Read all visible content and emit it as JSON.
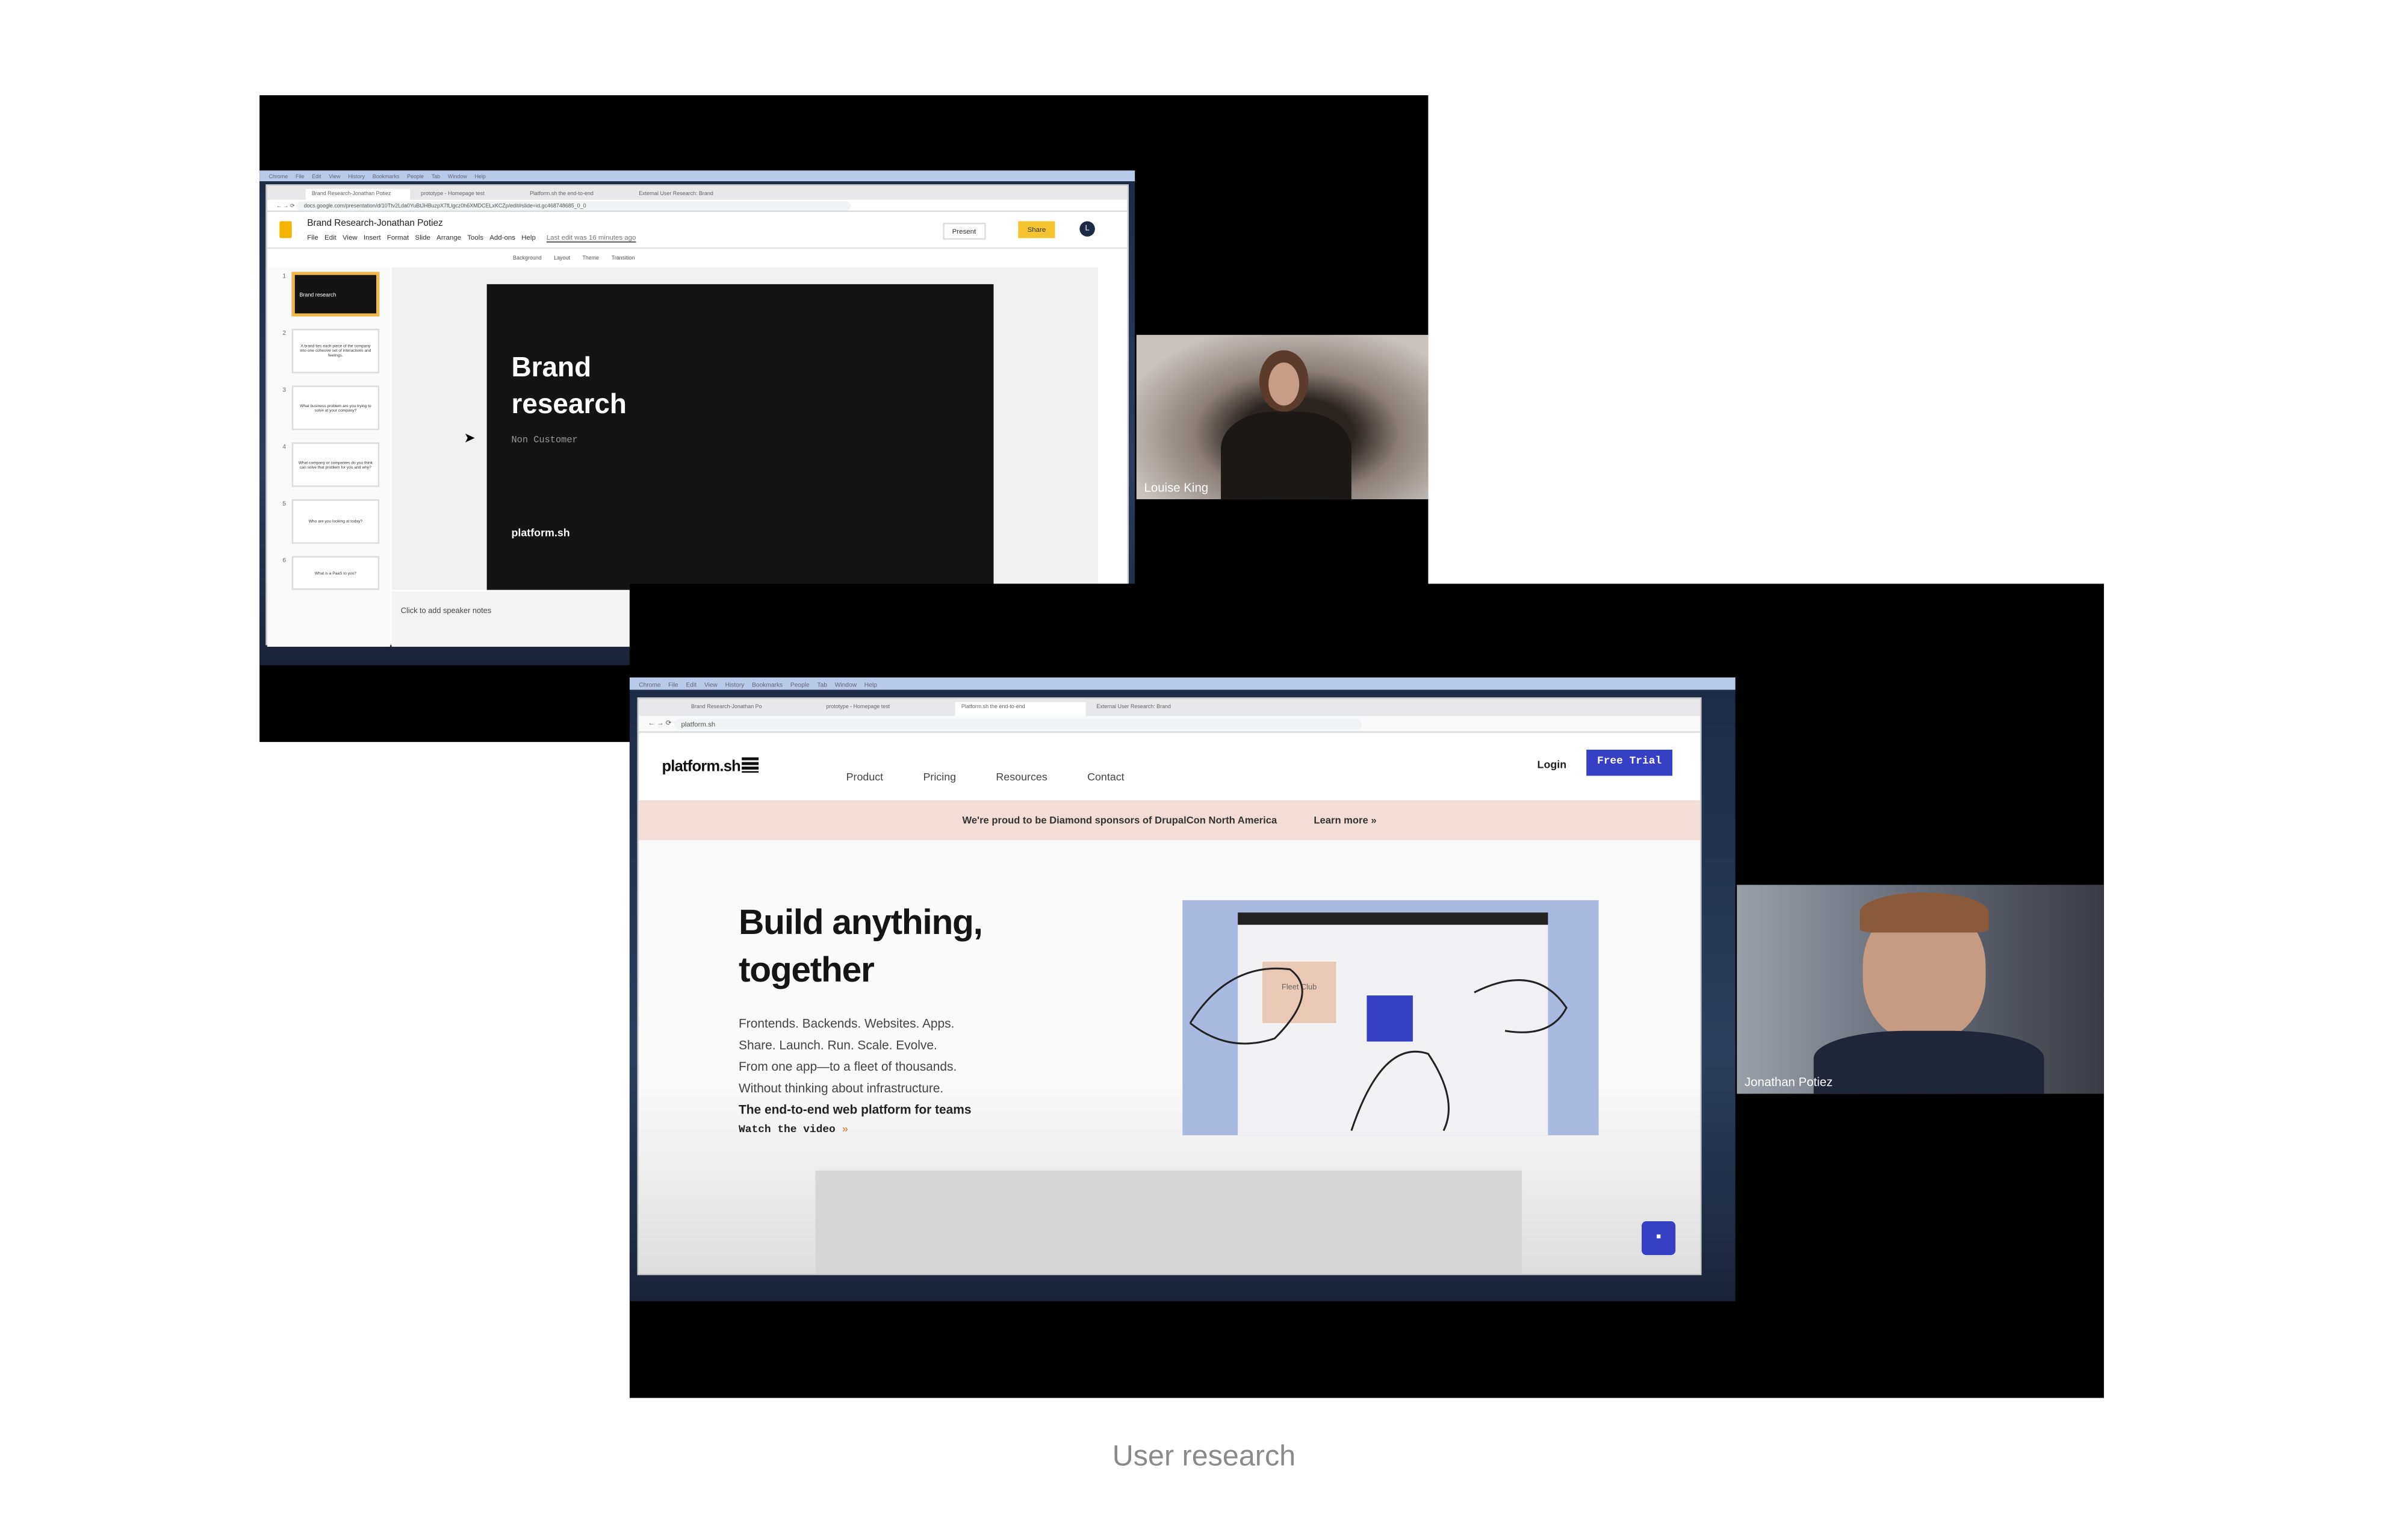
{
  "caption": "User research",
  "mac_menu": [
    "Chrome",
    "File",
    "Edit",
    "View",
    "History",
    "Bookmarks",
    "People",
    "Tab",
    "Window",
    "Help"
  ],
  "call1": {
    "participant": "Louise King",
    "browser": {
      "tabs": [
        "Brand Research-Jonathan Potiez",
        "prototype - Homepage test",
        "Platform.sh the end-to-end",
        "External User Research: Brand"
      ],
      "active_tab": 0,
      "url": "docs.google.com/presentation/d/10Ttv2Lda0YuBtJHBuzpX7fLlgcz0h6XMDCELxKCZp/edit#slide=id.gc468748685_0_0"
    },
    "slides_app": {
      "doc_title": "Brand Research-Jonathan Potiez",
      "menu": [
        "File",
        "Edit",
        "View",
        "Insert",
        "Format",
        "Slide",
        "Arrange",
        "Tools",
        "Add-ons",
        "Help"
      ],
      "last_edit": "Last edit was 16 minutes ago",
      "present_label": "Present",
      "share_label": "Share",
      "avatar_letter": "L",
      "toolbar": [
        "Background",
        "Layout",
        "Theme",
        "Transition"
      ],
      "thumbnails": [
        {
          "num": "1",
          "text": "Brand research"
        },
        {
          "num": "2",
          "text": "A brand ties each piece of the company into one cohesive set of interactions and feelings."
        },
        {
          "num": "3",
          "text": "What business problem are you trying to solve at your company?"
        },
        {
          "num": "4",
          "text": "What company or companies do you think can solve that problem for you and why?"
        },
        {
          "num": "5",
          "text": "Who are you looking at today?"
        },
        {
          "num": "6",
          "text": "What is a PaaS to you?"
        }
      ],
      "slide": {
        "title_line1": "Brand",
        "title_line2": "research",
        "subtitle": "Non Customer",
        "logo": "platform.sh"
      },
      "speaker_notes_placeholder": "Click to add speaker notes"
    }
  },
  "call2": {
    "participant": "Jonathan Potiez",
    "browser": {
      "tabs": [
        "Brand Research-Jonathan Po",
        "prototype - Homepage test",
        "Platform.sh the end-to-end",
        "External User Research: Brand"
      ],
      "active_tab": 2,
      "url": "platform.sh"
    },
    "site": {
      "logo": "platform.sh",
      "nav": [
        "Product",
        "Pricing",
        "Resources",
        "Contact"
      ],
      "login": "Login",
      "cta": "Free Trial",
      "banner_text": "We're proud to be Diamond sponsors of DrupalCon North America",
      "banner_link": "Learn more »",
      "hero_line1": "Build anything,",
      "hero_line2": "together",
      "body_lines": [
        "Frontends. Backends. Websites. Apps.",
        "Share. Launch. Run. Scale. Evolve.",
        "From one app—to a fleet of thousands.",
        "Without thinking about infrastructure."
      ],
      "tagline": "The end-to-end web platform for teams",
      "watch_video": "Watch the video",
      "illustration_label": "Fleet Club"
    },
    "colors": {
      "cta": "#3640c4",
      "banner": "#f3ded7",
      "illustration": "#a9b9e0"
    }
  }
}
